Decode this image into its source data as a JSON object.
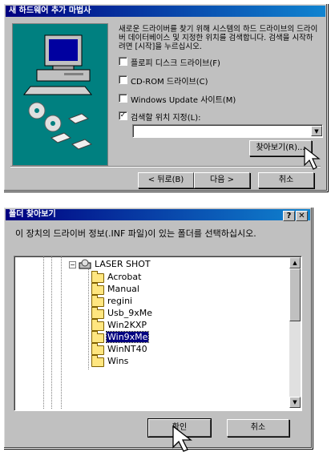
{
  "wizard": {
    "title": "새 하드웨어 추가 마법사",
    "description": "새로운 드라이버를 찾기 위해 시스템의 하드 드라이브의 드라이버 데이터베이스 및 지정한 위치를 검색합니다. 검색을 시작하려면 [시작]을 누르십시오.",
    "options": [
      {
        "label": "플로피 디스크 드라이브(F)",
        "checked": false
      },
      {
        "label": "CD-ROM 드라이브(C)",
        "checked": false
      },
      {
        "label": "Windows Update 사이트(M)",
        "checked": false
      },
      {
        "label": "검색할 위치 지정(L):",
        "checked": true
      }
    ],
    "path_value": "",
    "browse_label": "찾아보기(R)...",
    "back_label": "< 뒤로(B)",
    "next_label": "다음 >",
    "cancel_label": "취소"
  },
  "browse": {
    "title": "폴더 찾아보기",
    "help_label": "?",
    "close_label": "✕",
    "instruction": "이 장치의 드라이버 정보(.INF 파일)이 있는 폴더를 선택하십시오.",
    "root": "LASER SHOT",
    "folders": [
      "Acrobat",
      "Manual",
      "regini",
      "Usb_9xMe",
      "Win2KXP",
      "Win9xMe",
      "WinNT40",
      "Wins"
    ],
    "selected": "Win9xMe",
    "ok_label": "확인",
    "cancel_label": "취소"
  }
}
